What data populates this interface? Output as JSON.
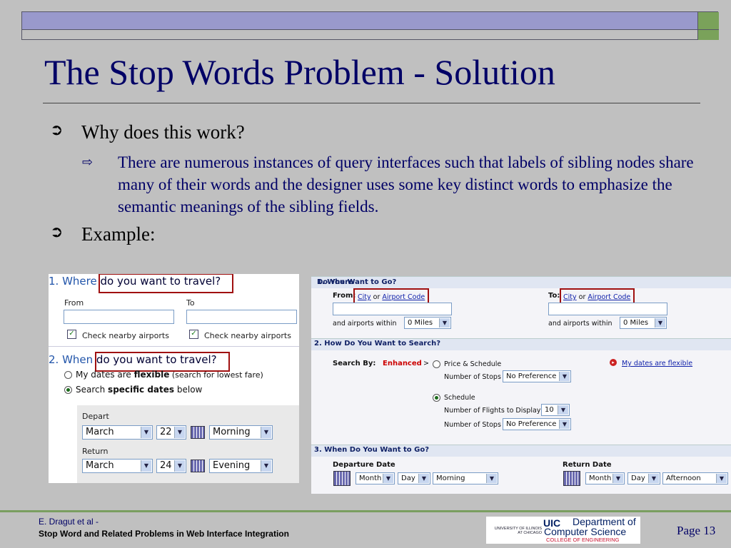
{
  "slide": {
    "title": "The Stop Words Problem - Solution",
    "bullets": [
      {
        "text": "Why does this work?"
      },
      {
        "text": "There are numerous instances of query interfaces such that labels of sibling nodes share many of their words and the designer uses some key distinct words to emphasize the semantic meanings of the sibling fields."
      },
      {
        "text": "Example:"
      }
    ],
    "bullet_icon": "arrow-bullet-icon",
    "sub_bullet_icon": "hollow-arrow-icon"
  },
  "left_form": {
    "heading1_a": "1. Where ",
    "heading1_b": "do you want to travel?",
    "from_label": "From",
    "to_label": "To",
    "nearby_label": "Check nearby airports",
    "heading2_a": "2. When ",
    "heading2_b": "do you want to travel?",
    "radio1_a": "My dates are ",
    "radio1_b": "flexible",
    "radio1_c": " (search for lowest fare)",
    "radio2_a": "Search ",
    "radio2_b": "specific dates",
    "radio2_c": " below",
    "depart_label": "Depart",
    "depart_month": "March",
    "depart_day": "22",
    "depart_time": "Morning",
    "return_label": "Return",
    "return_month": "March",
    "return_day": "24",
    "return_time": "Evening"
  },
  "right_form": {
    "section1_a": "1. Where ",
    "section1_b": "Do You Want to Go?",
    "from_label": "From:",
    "to_label": "To:",
    "city_link": "City",
    "or_text": "or",
    "airport_link": "Airport Code",
    "within_label": "and airports within",
    "miles_value": "0 Miles",
    "section2": "2. How Do You Want to Search?",
    "search_by": "Search By:",
    "enhanced": "Enhanced",
    "gt": ">",
    "price_schedule": "Price & Schedule",
    "stops_label": "Number of Stops",
    "stops_value": "No Preference",
    "flexible_link": "My dates are flexible",
    "schedule": "Schedule",
    "flights_label": "Number of Flights to Display",
    "flights_value": "10",
    "section3": "3. When Do You Want to Go?",
    "departure_date": "Departure Date",
    "return_date": "Return Date",
    "month": "Month",
    "day": "Day",
    "dep_time": "Morning",
    "ret_time": "Afternoon"
  },
  "footer": {
    "author": "E. Dragut et al -",
    "talk_title": "Stop Word and Related Problems in Web Interface Integration",
    "uic_small": "UNIVERSITY OF ILLINOIS AT CHICAGO",
    "uic_logo": "UIC",
    "dept_line1": "Department of",
    "dept_line2": "Computer Science",
    "college": "COLLEGE OF ENGINEERING",
    "page": "Page 13"
  }
}
